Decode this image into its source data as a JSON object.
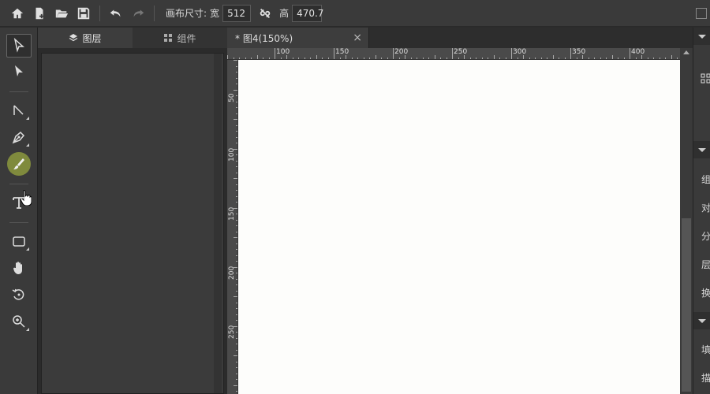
{
  "topbar": {
    "canvas_size_label": "画布尺寸:",
    "width_label": "宽",
    "width_value": "512",
    "height_label": "高",
    "height_value": "470.7"
  },
  "panel_tabs": {
    "layers": "图层",
    "components": "组件"
  },
  "document": {
    "tab_title": "* 图4(150%)",
    "close": "×"
  },
  "ruler": {
    "horizontal_labels": [
      "100",
      "150",
      "200",
      "250",
      "300",
      "350",
      "400"
    ],
    "vertical_labels": [
      "50",
      "100",
      "150",
      "200",
      "250"
    ]
  },
  "right_panel": {
    "items": [
      "组",
      "对",
      "分",
      "层",
      "换",
      "填",
      "描"
    ]
  }
}
